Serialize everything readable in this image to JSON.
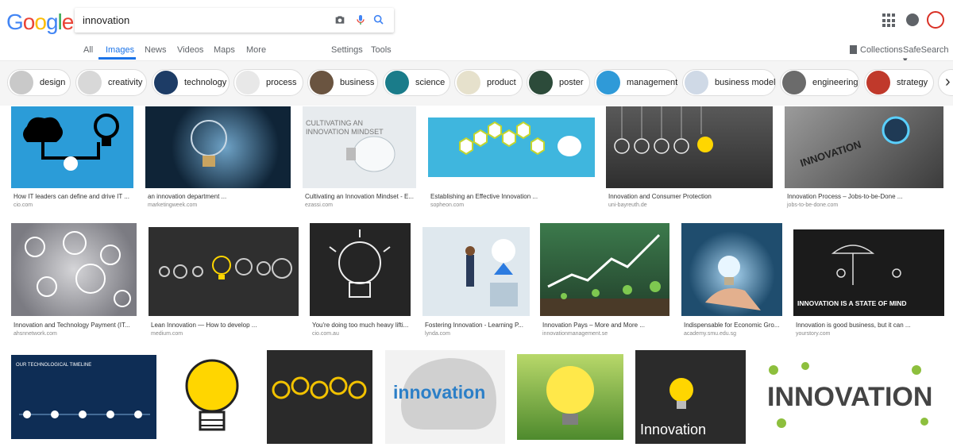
{
  "logo": [
    "G",
    "o",
    "o",
    "g",
    "l",
    "e"
  ],
  "search": {
    "query": "innovation"
  },
  "tabs": [
    "All",
    "Images",
    "News",
    "Videos",
    "Maps",
    "More"
  ],
  "tools": [
    "Settings",
    "Tools"
  ],
  "right": {
    "collections": "Collections",
    "safesearch": "SafeSearch ▾"
  },
  "chips": [
    {
      "label": "design",
      "color": "#c9c9c9"
    },
    {
      "label": "creativity",
      "color": "#d8d8d8"
    },
    {
      "label": "technology",
      "color": "#1d3c66"
    },
    {
      "label": "process",
      "color": "#e8e8e8"
    },
    {
      "label": "business",
      "color": "#6a5440"
    },
    {
      "label": "science",
      "color": "#1a7c8a"
    },
    {
      "label": "product",
      "color": "#e6e1cc"
    },
    {
      "label": "poster",
      "color": "#2c4b3a"
    },
    {
      "label": "management",
      "color": "#2f9ad8"
    },
    {
      "label": "business model",
      "color": "#cfd9e6"
    },
    {
      "label": "engineering",
      "color": "#6b6b6b"
    },
    {
      "label": "strategy",
      "color": "#c0392b"
    }
  ],
  "results": [
    {
      "title": "How IT leaders can define and drive IT ...",
      "site": "cio.com",
      "bg": "#2b9cd8"
    },
    {
      "title": "an innovation department ...",
      "site": "marketingweek.com",
      "bg": "#0f2437"
    },
    {
      "title": "Cultivating an Innovation Mindset - E...",
      "site": "ezassi.com",
      "bg": "#e7ebee",
      "caption": "CULTIVATING AN INNOVATION MINDSET"
    },
    {
      "title": "Establishing an Effective Innovation ...",
      "site": "sopheon.com",
      "bg": "#3fb6de"
    },
    {
      "title": "Innovation and Consumer Protection",
      "site": "uni-bayreuth.de",
      "bg": "#3d3d3d"
    },
    {
      "title": "Innovation Process – Jobs-to-be-Done ...",
      "site": "jobs-to-be-done.com",
      "bg": "#6c6c6c",
      "caption": "INNOVATION"
    },
    {
      "title": "Innovation and Technology Payment (IT...",
      "site": "ahsnnetwork.com",
      "bg": "#9a9aa0"
    },
    {
      "title": "Lean Innovation — How to develop ...",
      "site": "medium.com",
      "bg": "#2f2f2f"
    },
    {
      "title": "You're doing too much heavy lifti...",
      "site": "cio.com.au",
      "bg": "#252525"
    },
    {
      "title": "Fostering Innovation - Learning P...",
      "site": "lynda.com",
      "bg": "#dfe8ee"
    },
    {
      "title": "Innovation Pays – More and More ...",
      "site": "innovationmanagement.se",
      "bg": "#2e5a3a"
    },
    {
      "title": "Indispensable for Economic Gro...",
      "site": "academy.smu.edu.sg",
      "bg": "#1f4d6e"
    },
    {
      "title": "Innovation is good business, but it can ...",
      "site": "yourstory.com",
      "bg": "#1b1b1b",
      "caption": "INNOVATION IS A STATE OF MIND"
    },
    {
      "bg": "#0e2d55",
      "caption": "OUR TECHNOLOGICAL TIMELINE"
    },
    {
      "bg": "#ffffff"
    },
    {
      "bg": "#2a2a2a"
    },
    {
      "bg": "#f2f2f2",
      "caption": "innovation"
    },
    {
      "bg": "#8dbf3d"
    },
    {
      "bg": "#2b2b2b",
      "caption": "Innovation"
    },
    {
      "bg": "#ffffff",
      "caption": "INNOVATION"
    }
  ]
}
